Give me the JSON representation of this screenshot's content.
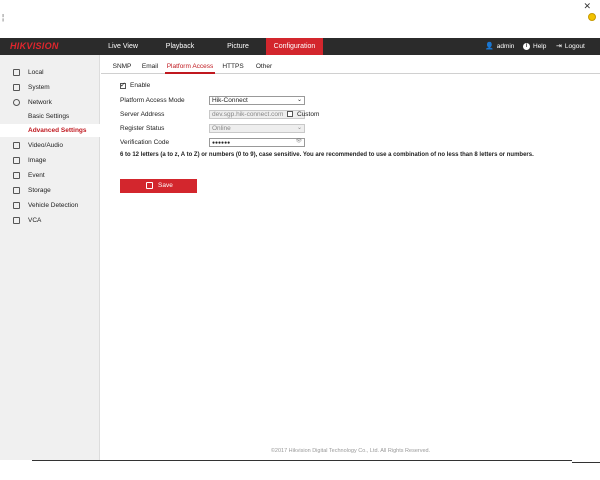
{
  "window": {
    "close_glyph": "✕"
  },
  "brand": {
    "logo": "HIKVISION"
  },
  "nav": {
    "tabs": [
      {
        "label": "Live View"
      },
      {
        "label": "Playback"
      },
      {
        "label": "Picture"
      },
      {
        "label": "Configuration"
      }
    ],
    "user": "admin",
    "help": "Help",
    "logout": "Logout"
  },
  "sidebar": {
    "items": [
      {
        "label": "Local",
        "icon": "monitor-icon"
      },
      {
        "label": "System",
        "icon": "system-icon"
      },
      {
        "label": "Network",
        "icon": "globe-icon"
      },
      {
        "label": "Video/Audio",
        "icon": "camera-icon"
      },
      {
        "label": "Image",
        "icon": "image-icon"
      },
      {
        "label": "Event",
        "icon": "calendar-icon"
      },
      {
        "label": "Storage",
        "icon": "storage-icon"
      },
      {
        "label": "Vehicle Detection",
        "icon": "vehicle-icon"
      },
      {
        "label": "VCA",
        "icon": "vca-icon"
      }
    ],
    "network_sub": [
      {
        "label": "Basic Settings"
      },
      {
        "label": "Advanced Settings"
      }
    ]
  },
  "subtabs": [
    {
      "label": "SNMP"
    },
    {
      "label": "Email"
    },
    {
      "label": "Platform Access"
    },
    {
      "label": "HTTPS"
    },
    {
      "label": "Other"
    }
  ],
  "form": {
    "enable_label": "Enable",
    "enable_checked": true,
    "mode_label": "Platform Access Mode",
    "mode_value": "Hik-Connect",
    "server_label": "Server Address",
    "server_value": "dev.sgp.hik-connect.com",
    "custom_label": "Custom",
    "status_label": "Register Status",
    "status_value": "Online",
    "code_label": "Verification Code",
    "code_value": "●●●●●●",
    "note": "6 to 12 letters (a to z, A to Z) or numbers (0 to 9), case sensitive. You are recommended to use a combination of no less than 8 letters or numbers.",
    "save_label": "Save"
  },
  "footer": "©2017 Hikvision Digital Technology Co., Ltd. All Rights Reserved.",
  "colors": {
    "accent": "#d3262d",
    "topbar": "#2b2b2b",
    "sidebar": "#f0f0f0"
  }
}
